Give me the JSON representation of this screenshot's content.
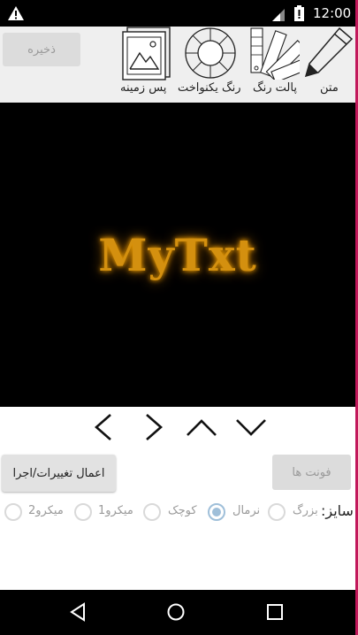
{
  "status_bar": {
    "time": "12:00"
  },
  "toolbar": {
    "save_label": "ذخیره",
    "tools": [
      {
        "label": "متن",
        "icon": "pencil-icon"
      },
      {
        "label": "پالت رنگ",
        "icon": "palette-icon"
      },
      {
        "label": "رنگ یکنواخت",
        "icon": "color-wheel-icon"
      },
      {
        "label": "پس زمینه",
        "icon": "image-icon"
      }
    ]
  },
  "preview": {
    "text": "MyTxt",
    "text_color": "#d4900f",
    "glow_color": "#ffaa00",
    "background": "#000000"
  },
  "arrows": [
    "chevron-left-icon",
    "chevron-right-icon",
    "chevron-up-icon",
    "chevron-down-icon"
  ],
  "actions": {
    "apply_label": "اعمال تغییرات/اجرا",
    "fonts_label": "فونت ها"
  },
  "size": {
    "label": "سایز:",
    "options": [
      "بزرگ",
      "نرمال",
      "کوچک",
      "میکرو1",
      "میکرو2"
    ],
    "selected": "نرمال"
  },
  "nav": [
    "back-icon",
    "home-icon",
    "recents-icon"
  ]
}
